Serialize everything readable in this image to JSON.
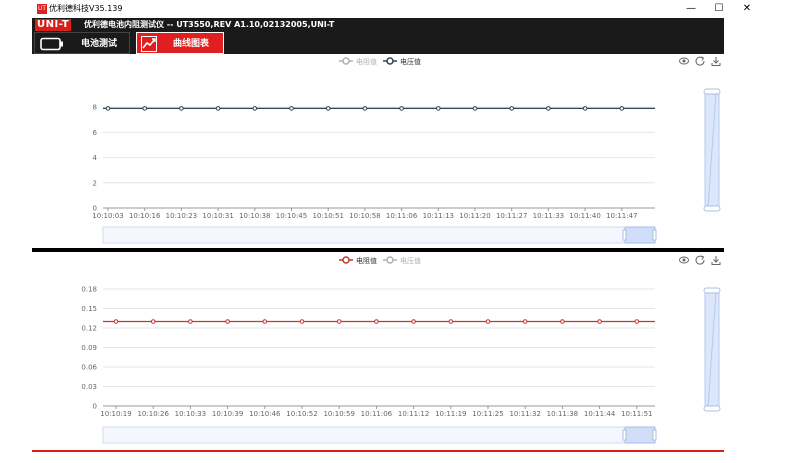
{
  "window": {
    "title": "优利德科技V35.139",
    "app_icon": "UT"
  },
  "header": {
    "logo": "UNI-T",
    "title": "优利德电池内阻测试仪 -- UT3550,REV A1.10,02132005,UNI-T"
  },
  "tabs": [
    {
      "label": "电池测试",
      "icon": "battery-icon",
      "active": false
    },
    {
      "label": "曲线图表",
      "icon": "line-chart-icon",
      "active": true
    }
  ],
  "toolbox_icons": [
    "eye-icon",
    "refresh-icon",
    "download-icon"
  ],
  "colors": {
    "accent": "#e02020",
    "voltage": "#2f4554",
    "resistance": "#c23531",
    "dark": "#1a1a1a"
  },
  "chart_data": [
    {
      "type": "line",
      "legend": [
        "电阻值",
        "电压值"
      ],
      "legend_active": [
        false,
        true
      ],
      "x": [
        "10:10:03",
        "10:10:16",
        "10:10:23",
        "10:10:31",
        "10:10:38",
        "10:10:45",
        "10:10:51",
        "10:10:58",
        "10:11:06",
        "10:11:13",
        "10:11:20",
        "10:11:27",
        "10:11:33",
        "10:11:40",
        "10:11:47"
      ],
      "yticks": [
        "0",
        "2",
        "4",
        "6",
        "8"
      ],
      "ylim": [
        0,
        9.2
      ],
      "series": [
        {
          "name": "电压值",
          "color": "#2f4554",
          "values": [
            7.9,
            7.9,
            7.9,
            7.9,
            7.9,
            7.9,
            7.9,
            7.9,
            7.9,
            7.9,
            7.9,
            7.9,
            7.9,
            7.9,
            7.9
          ]
        }
      ],
      "grid": true,
      "legend_position": "top-center"
    },
    {
      "type": "line",
      "legend": [
        "电阻值",
        "电压值"
      ],
      "legend_active": [
        true,
        false
      ],
      "x": [
        "10:10:19",
        "10:10:26",
        "10:10:33",
        "10:10:39",
        "10:10:46",
        "10:10:52",
        "10:10:59",
        "10:11:06",
        "10:11:12",
        "10:11:19",
        "10:11:25",
        "10:11:32",
        "10:11:38",
        "10:11:44",
        "10:11:51"
      ],
      "yticks": [
        "0",
        "0.03",
        "0.06",
        "0.09",
        "0.12",
        "0.15",
        "0.18"
      ],
      "ylim": [
        0,
        0.18
      ],
      "series": [
        {
          "name": "电阻值",
          "color": "#c23531",
          "values": [
            0.13,
            0.13,
            0.13,
            0.13,
            0.13,
            0.13,
            0.13,
            0.13,
            0.13,
            0.13,
            0.13,
            0.13,
            0.13,
            0.13,
            0.13
          ]
        }
      ],
      "grid": true,
      "legend_position": "top-center"
    }
  ]
}
